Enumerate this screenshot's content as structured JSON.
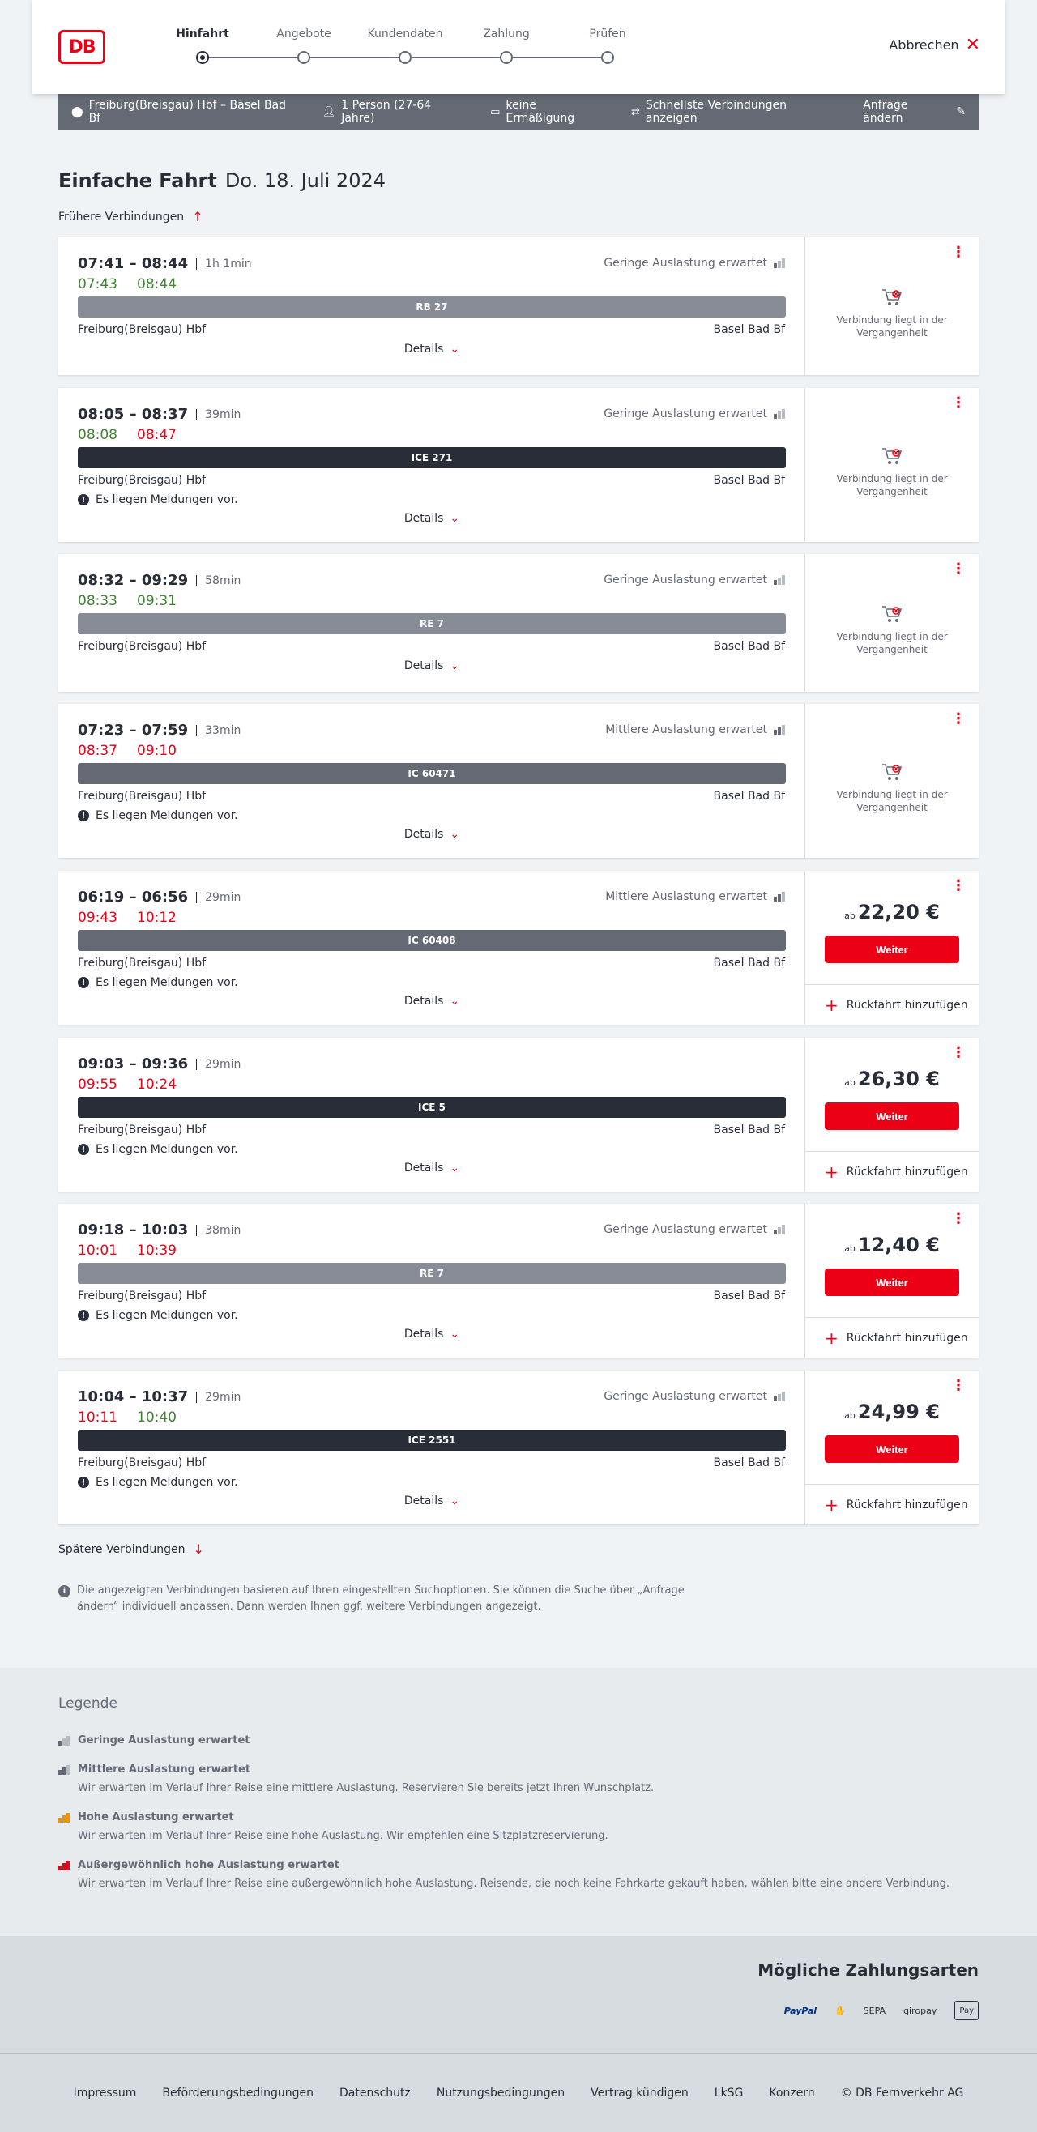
{
  "header": {
    "logo": "DB",
    "steps": [
      {
        "label": "Hinfahrt",
        "active": true
      },
      {
        "label": "Angebote",
        "active": false
      },
      {
        "label": "Kundendaten",
        "active": false
      },
      {
        "label": "Zahlung",
        "active": false
      },
      {
        "label": "Prüfen",
        "active": false
      }
    ],
    "cancel_label": "Abbrechen"
  },
  "searchbar": {
    "route": "Freiburg(Breisgau) Hbf – Basel Bad Bf",
    "passengers": "1 Person (27-64 Jahre)",
    "discount": "keine Ermäßigung",
    "option": "Schnellste Verbindungen anzeigen",
    "edit_label": "Anfrage ändern"
  },
  "page": {
    "title": "Einfache Fahrt",
    "date": "Do. 18. Juli 2024",
    "earlier_label": "Frühere Verbindungen",
    "later_label": "Spätere Verbindungen",
    "details_label": "Details",
    "past_label": "Verbindung liegt in der Vergangenheit",
    "weiter_label": "Weiter",
    "return_label": "Rückfahrt hinzufügen",
    "price_prefix": "ab",
    "message_label": "Es liegen Meldungen vor."
  },
  "connections": [
    {
      "times": "07:41 – 08:44",
      "duration": "1h 1min",
      "rt_dep": "07:43",
      "rt_dep_late": false,
      "rt_arr": "08:44",
      "rt_arr_late": false,
      "load": "Geringe Auslastung erwartet",
      "load_level": 1,
      "train": "RB 27",
      "bar": "light",
      "from": "Freiburg(Breisgau) Hbf",
      "to": "Basel Bad Bf",
      "message": false,
      "past": true,
      "price": ""
    },
    {
      "times": "08:05 – 08:37",
      "duration": "39min",
      "rt_dep": "08:08",
      "rt_dep_late": false,
      "rt_arr": "08:47",
      "rt_arr_late": true,
      "load": "Geringe Auslastung erwartet",
      "load_level": 1,
      "train": "ICE 271",
      "bar": "dark",
      "from": "Freiburg(Breisgau) Hbf",
      "to": "Basel Bad Bf",
      "message": true,
      "past": true,
      "price": ""
    },
    {
      "times": "08:32 – 09:29",
      "duration": "58min",
      "rt_dep": "08:33",
      "rt_dep_late": false,
      "rt_arr": "09:31",
      "rt_arr_late": false,
      "load": "Geringe Auslastung erwartet",
      "load_level": 1,
      "train": "RE 7",
      "bar": "light",
      "from": "Freiburg(Breisgau) Hbf",
      "to": "Basel Bad Bf",
      "message": false,
      "past": true,
      "price": ""
    },
    {
      "times": "07:23 – 07:59",
      "duration": "33min",
      "rt_dep": "08:37",
      "rt_dep_late": true,
      "rt_arr": "09:10",
      "rt_arr_late": true,
      "load": "Mittlere Auslastung erwartet",
      "load_level": 2,
      "train": "IC 60471",
      "bar": "mid",
      "from": "Freiburg(Breisgau) Hbf",
      "to": "Basel Bad Bf",
      "message": true,
      "past": true,
      "price": ""
    },
    {
      "times": "06:19 – 06:56",
      "duration": "29min",
      "rt_dep": "09:43",
      "rt_dep_late": true,
      "rt_arr": "10:12",
      "rt_arr_late": true,
      "load": "Mittlere Auslastung erwartet",
      "load_level": 2,
      "train": "IC 60408",
      "bar": "mid",
      "from": "Freiburg(Breisgau) Hbf",
      "to": "Basel Bad Bf",
      "message": true,
      "past": false,
      "price": "22,20 €"
    },
    {
      "times": "09:03 – 09:36",
      "duration": "29min",
      "rt_dep": "09:55",
      "rt_dep_late": true,
      "rt_arr": "10:24",
      "rt_arr_late": true,
      "load": "",
      "load_level": 0,
      "train": "ICE 5",
      "bar": "dark",
      "from": "Freiburg(Breisgau) Hbf",
      "to": "Basel Bad Bf",
      "message": true,
      "past": false,
      "price": "26,30 €"
    },
    {
      "times": "09:18 – 10:03",
      "duration": "38min",
      "rt_dep": "10:01",
      "rt_dep_late": true,
      "rt_arr": "10:39",
      "rt_arr_late": true,
      "load": "Geringe Auslastung erwartet",
      "load_level": 1,
      "train": "RE 7",
      "bar": "light",
      "from": "Freiburg(Breisgau) Hbf",
      "to": "Basel Bad Bf",
      "message": true,
      "past": false,
      "price": "12,40 €"
    },
    {
      "times": "10:04 – 10:37",
      "duration": "29min",
      "rt_dep": "10:11",
      "rt_dep_late": true,
      "rt_arr": "10:40",
      "rt_arr_late": false,
      "load": "Geringe Auslastung erwartet",
      "load_level": 1,
      "train": "ICE 2551",
      "bar": "dark",
      "from": "Freiburg(Breisgau) Hbf",
      "to": "Basel Bad Bf",
      "message": true,
      "past": false,
      "price": "24,99 €"
    }
  ],
  "info": "Die angezeigten Verbindungen basieren auf Ihren eingestellten Suchoptionen. Sie können die Suche über „Anfrage ändern“ individuell anpassen. Dann werden Ihnen ggf. weitere Verbindungen angezeigt.",
  "legend": {
    "title": "Legende",
    "items": [
      {
        "title": "Geringe Auslastung erwartet",
        "desc": "",
        "level": 1,
        "color": "#646973"
      },
      {
        "title": "Mittlere Auslastung erwartet",
        "desc": "Wir erwarten im Verlauf Ihrer Reise eine mittlere Auslastung. Reservieren Sie bereits jetzt Ihren Wunschplatz.",
        "level": 2,
        "color": "#646973"
      },
      {
        "title": "Hohe Auslastung erwartet",
        "desc": "Wir erwarten im Verlauf Ihrer Reise eine hohe Auslastung. Wir empfehlen eine Sitzplatzreservierung.",
        "level": 3,
        "color": "#f39200"
      },
      {
        "title": "Außergewöhnlich hohe Auslastung erwartet",
        "desc": "Wir erwarten im Verlauf Ihrer Reise eine außergewöhnlich hohe Auslastung. Reisende, die noch keine Fahrkarte gekauft haben, wählen bitte eine andere Verbindung.",
        "level": 4,
        "color": "#ec0016"
      }
    ]
  },
  "payment": {
    "title": "Mögliche Zahlungsarten",
    "methods": [
      {
        "name": "paypal-icon",
        "label": "PayPal"
      },
      {
        "name": "card-icon",
        "label": "✋"
      },
      {
        "name": "sepa-icon",
        "label": "SEPA"
      },
      {
        "name": "giropay-icon",
        "label": "giropay"
      },
      {
        "name": "applepay-icon",
        "label": "Pay"
      }
    ]
  },
  "footer": {
    "links": [
      "Impressum",
      "Beförderungsbedingungen",
      "Datenschutz",
      "Nutzungsbedingungen",
      "Vertrag kündigen",
      "LkSG",
      "Konzern",
      "© DB Fernverkehr AG"
    ]
  }
}
